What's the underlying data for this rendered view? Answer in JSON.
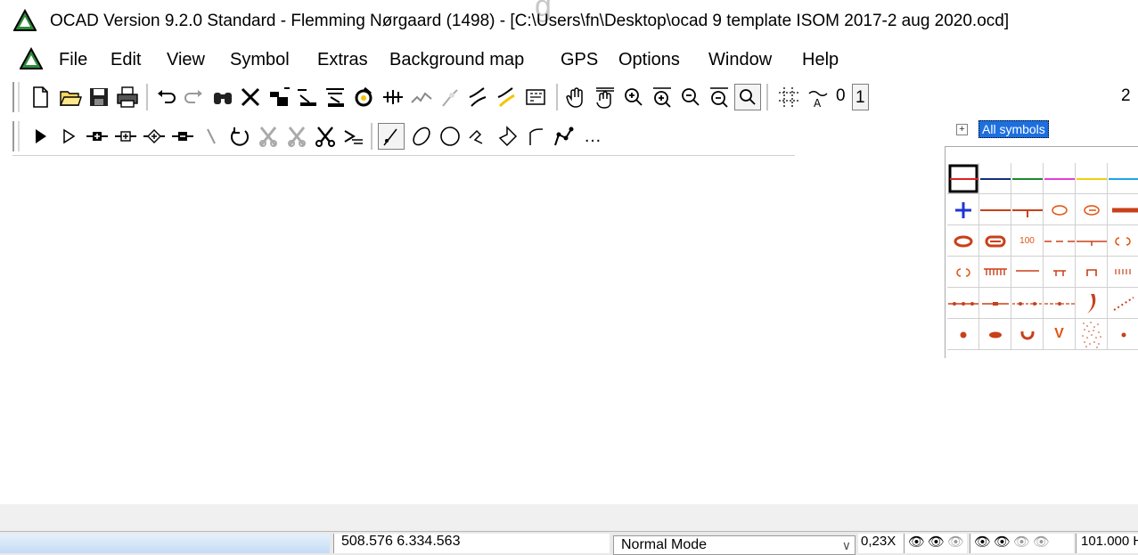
{
  "titlebar": {
    "title": "OCAD Version 9.2.0  Standard - Flemming Nørgaard (1498) - [C:\\Users\\fn\\Desktop\\ocad 9 template  ISOM 2017-2 aug 2020.ocd]",
    "logo_icon": "ocad-logo-icon"
  },
  "menu": {
    "items": [
      "File",
      "Edit",
      "View",
      "Symbol",
      "Extras",
      "Background map",
      "GPS",
      "Options",
      "Window",
      "Help"
    ]
  },
  "toolbar_main": {
    "icons": [
      "new-file-icon",
      "open-folder-icon",
      "save-icon",
      "print-icon",
      "undo-icon",
      "redo-icon",
      "find-icon",
      "delete-icon",
      "cut-icon",
      "move-icon",
      "move-parallel-icon",
      "rotate-icon",
      "stretch-icon",
      "mirror-icon",
      "join-icon",
      "bridge-icon",
      "measure-icon",
      "hand-pan-icon",
      "hand-pan-2-icon",
      "zoom-in-icon",
      "zoom-in-window-icon",
      "zoom-out-icon",
      "zoom-out-window-icon",
      "zoom-all-icon",
      "grid-icon",
      "text-icon"
    ],
    "number_buttons": [
      "0",
      "1",
      "2"
    ]
  },
  "toolbar_draw": {
    "icons": [
      "edit-object-icon",
      "edit-point-icon",
      "add-point-icon",
      "insert-point-icon",
      "corner-point-icon",
      "remove-point-icon",
      "cut-line-icon",
      "rotate-object-icon",
      "cut-hole-icon",
      "cut-area-icon",
      "scissors-icon",
      "fill-icon",
      "curve-mode-icon",
      "ellipse-icon",
      "circle-icon",
      "rectangle-icon",
      "polygon-icon",
      "straight-line-icon",
      "freehand-icon",
      "more-icon"
    ]
  },
  "symbols": {
    "tree_label": "All symbols",
    "tree_expander": "+",
    "grid_labels": [
      "100",
      "V"
    ]
  },
  "status": {
    "coordinates": "508.576  6.334.563",
    "mode": "Normal Mode",
    "zoom": "0,23X",
    "scale": "101.000 H"
  },
  "colors": {
    "accent_blue": "#1d6fe0",
    "symbol_orange": "#e0530f",
    "status_gradient_top": "#e6f0fb",
    "status_gradient_bottom": "#c5dcf6"
  }
}
